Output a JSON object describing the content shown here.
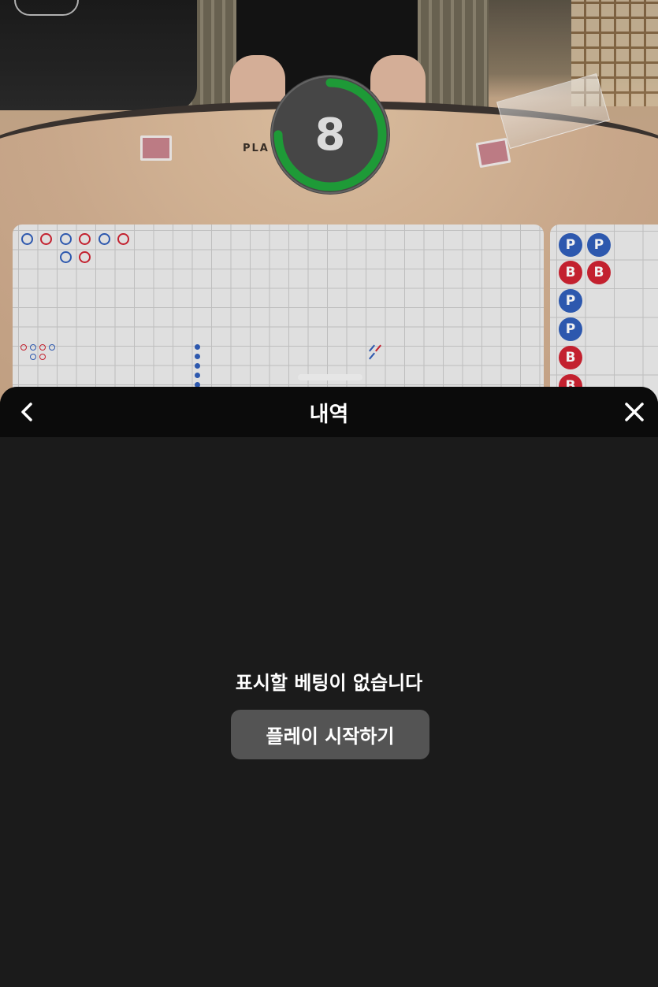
{
  "video": {
    "table_label": "PLA          ER",
    "countdown": "8",
    "countdown_progress": 0.75,
    "colors": {
      "timer_green": "#1fa33a",
      "banker_red": "#cf2331",
      "player_blue": "#2f5db8"
    }
  },
  "bead_road": {
    "beads": [
      {
        "label": "P",
        "side": "player"
      },
      {
        "label": "P",
        "side": "player"
      },
      {
        "label": "B",
        "side": "banker"
      },
      {
        "label": "B",
        "side": "banker"
      },
      {
        "label": "P",
        "side": "player"
      },
      {
        "label": "P",
        "side": "player"
      },
      {
        "label": "B",
        "side": "banker"
      },
      {
        "label": "B",
        "side": "banker"
      }
    ]
  },
  "sheet": {
    "title": "내역",
    "back_icon": "chevron-left-icon",
    "close_icon": "close-icon",
    "empty_message": "표시할 베팅이 없습니다",
    "start_button_label": "플레이 시작하기"
  }
}
